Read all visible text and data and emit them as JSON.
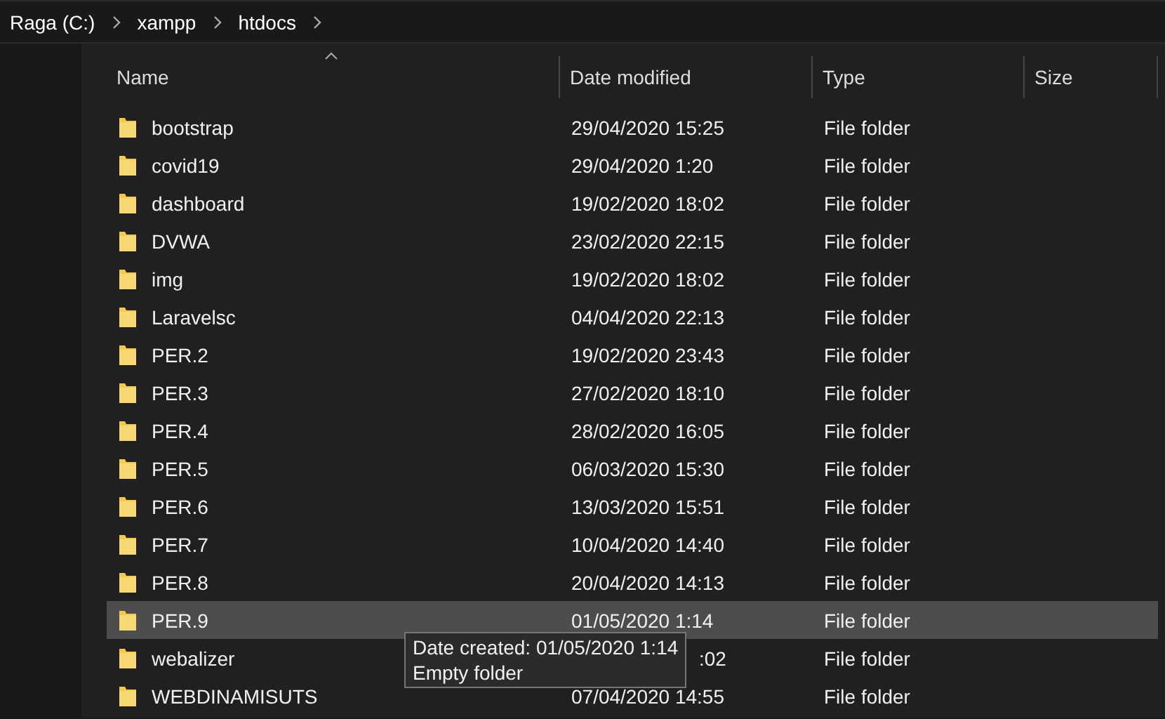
{
  "breadcrumb": [
    "Raga (C:)",
    "xampp",
    "htdocs"
  ],
  "columns": [
    "Name",
    "Date modified",
    "Type",
    "Size"
  ],
  "rows": [
    {
      "name": "bootstrap",
      "date": "29/04/2020 15:25",
      "type": "File folder",
      "selected": false,
      "covered": false
    },
    {
      "name": "covid19",
      "date": "29/04/2020 1:20",
      "type": "File folder",
      "selected": false,
      "covered": false
    },
    {
      "name": "dashboard",
      "date": "19/02/2020 18:02",
      "type": "File folder",
      "selected": false,
      "covered": false
    },
    {
      "name": "DVWA",
      "date": "23/02/2020 22:15",
      "type": "File folder",
      "selected": false,
      "covered": false
    },
    {
      "name": "img",
      "date": "19/02/2020 18:02",
      "type": "File folder",
      "selected": false,
      "covered": false
    },
    {
      "name": "Laravelsc",
      "date": "04/04/2020 22:13",
      "type": "File folder",
      "selected": false,
      "covered": false
    },
    {
      "name": "PER.2",
      "date": "19/02/2020 23:43",
      "type": "File folder",
      "selected": false,
      "covered": false
    },
    {
      "name": "PER.3",
      "date": "27/02/2020 18:10",
      "type": "File folder",
      "selected": false,
      "covered": false
    },
    {
      "name": "PER.4",
      "date": "28/02/2020 16:05",
      "type": "File folder",
      "selected": false,
      "covered": false
    },
    {
      "name": "PER.5",
      "date": "06/03/2020 15:30",
      "type": "File folder",
      "selected": false,
      "covered": false
    },
    {
      "name": "PER.6",
      "date": "13/03/2020 15:51",
      "type": "File folder",
      "selected": false,
      "covered": false
    },
    {
      "name": "PER.7",
      "date": "10/04/2020 14:40",
      "type": "File folder",
      "selected": false,
      "covered": false
    },
    {
      "name": "PER.8",
      "date": "20/04/2020 14:13",
      "type": "File folder",
      "selected": false,
      "covered": false
    },
    {
      "name": "PER.9",
      "date": "01/05/2020 1:14",
      "type": "File folder",
      "selected": true,
      "covered": false
    },
    {
      "name": "webalizer",
      "date": ":02",
      "type": "File folder",
      "selected": false,
      "covered": true
    },
    {
      "name": "WEBDINAMISUTS",
      "date": "07/04/2020 14:55",
      "type": "File folder",
      "selected": false,
      "covered": false
    }
  ],
  "tooltip": [
    "Date created: 01/05/2020 1:14",
    "Empty folder"
  ]
}
